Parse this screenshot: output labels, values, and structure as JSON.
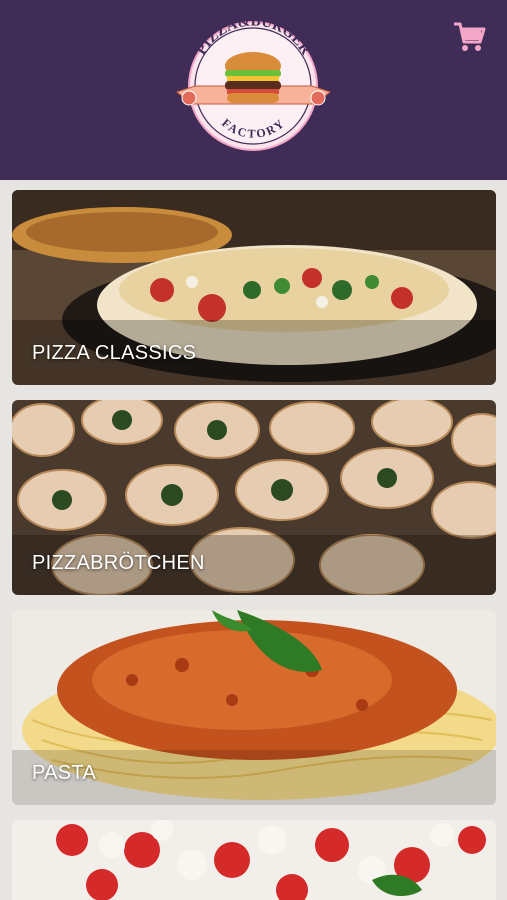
{
  "header": {
    "logo_text_top": "PIZZA&BURGER",
    "logo_text_bottom": "FACTORY",
    "cart_icon": "cart-icon",
    "background_color": "#3f2c57",
    "accent_color": "#f4a6c8"
  },
  "categories": [
    {
      "label": "PIZZA CLASSICS"
    },
    {
      "label": "PIZZABRÖTCHEN"
    },
    {
      "label": "PASTA"
    },
    {
      "label": ""
    }
  ]
}
